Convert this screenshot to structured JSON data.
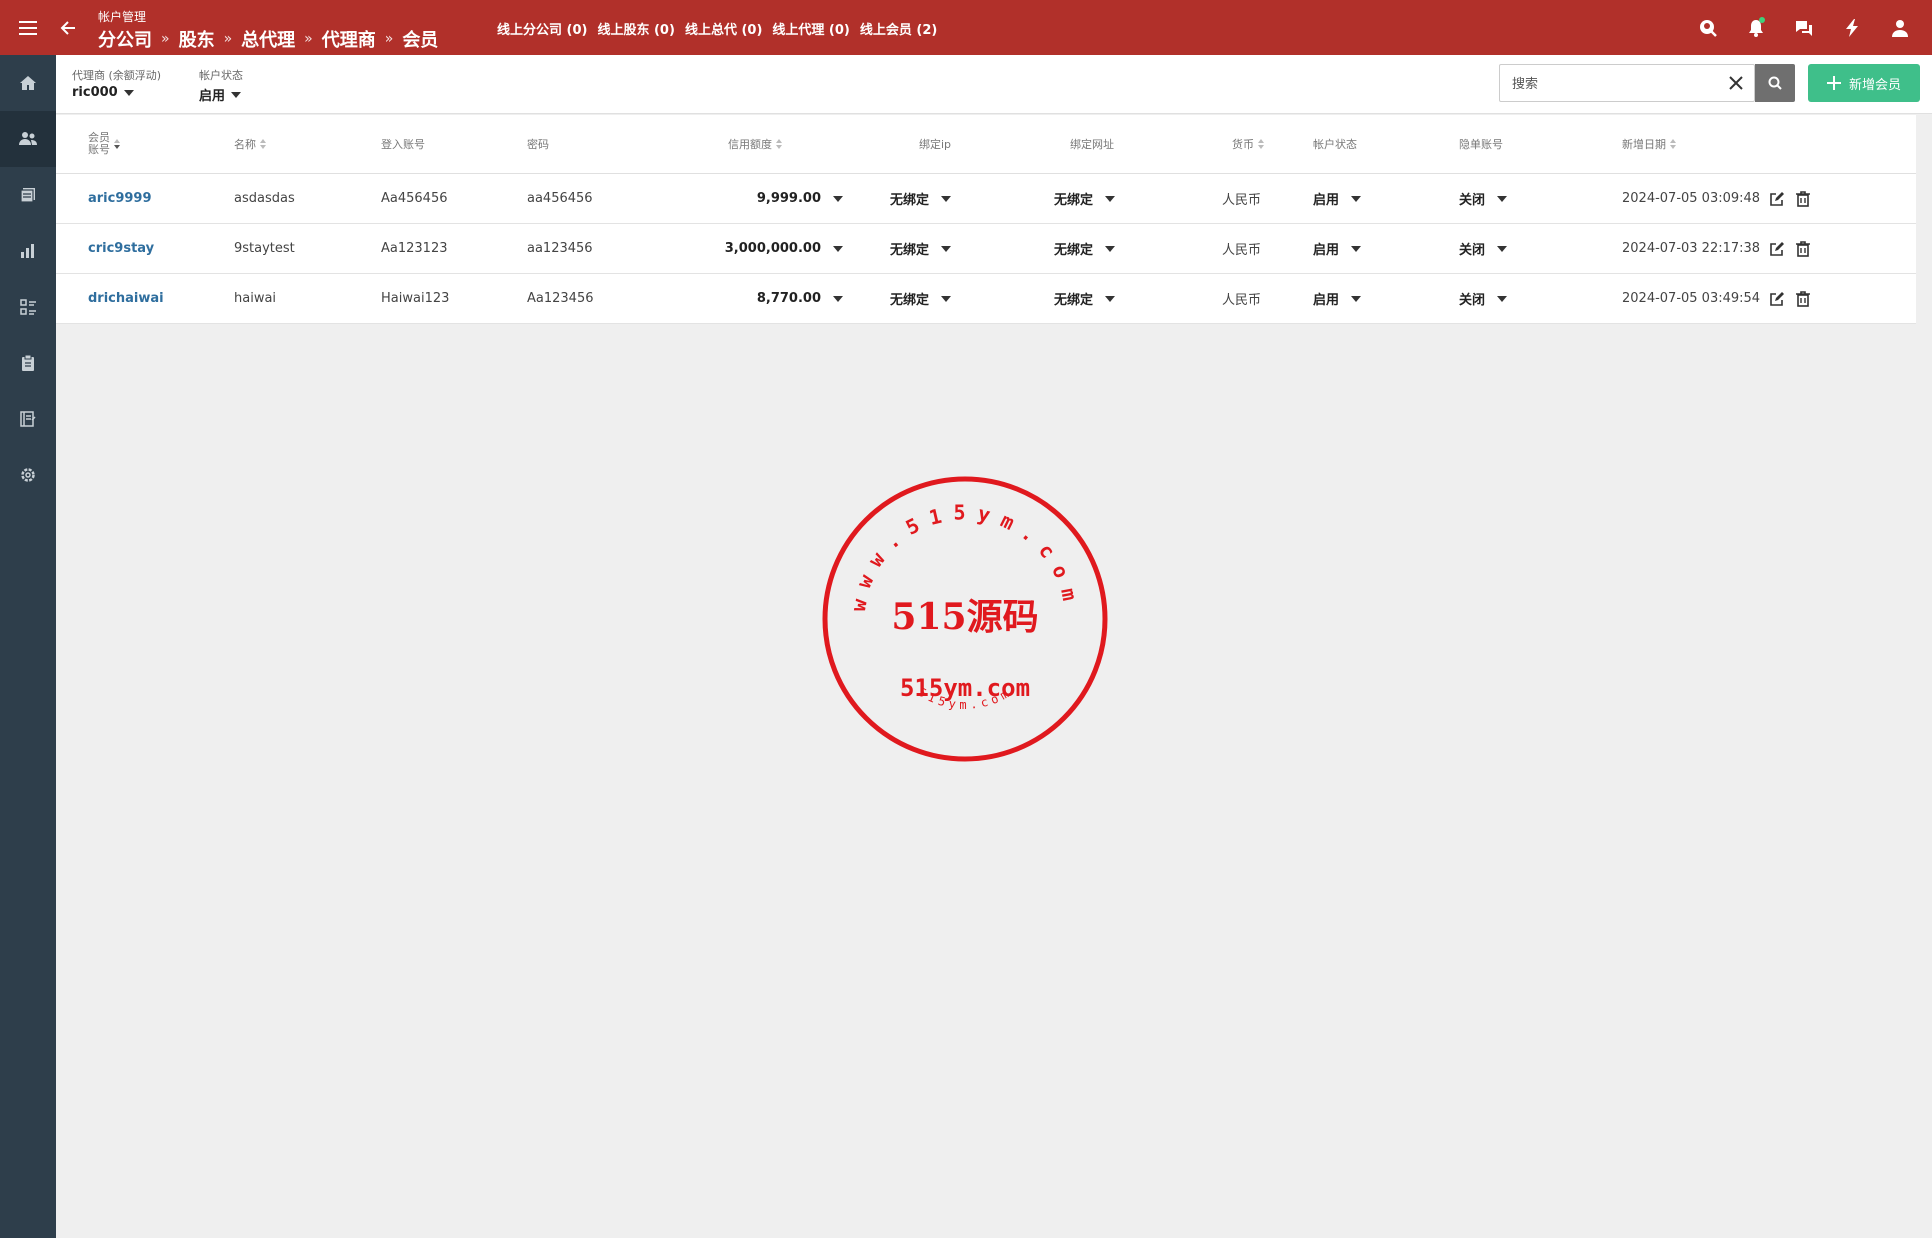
{
  "header": {
    "section_title": "帐户管理",
    "breadcrumb": [
      "分公司",
      "股东",
      "总代理",
      "代理商",
      "会员"
    ],
    "breadcrumb_sep": "»",
    "online_stats": [
      "线上分公司 (0)",
      "线上股东 (0)",
      "线上总代 (0)",
      "线上代理 (0)",
      "线上会员 (2)"
    ],
    "icons": [
      "menu-icon",
      "back-arrow-icon",
      "search-user-icon",
      "bell-icon",
      "chat-icon",
      "lightning-icon",
      "user-icon"
    ]
  },
  "sidebar": {
    "items": [
      {
        "icon": "home-icon",
        "active": false
      },
      {
        "icon": "users-icon",
        "active": true
      },
      {
        "icon": "documents-icon",
        "active": false
      },
      {
        "icon": "bar-chart-icon",
        "active": false
      },
      {
        "icon": "list-icon",
        "active": false
      },
      {
        "icon": "clipboard-icon",
        "active": false
      },
      {
        "icon": "notebook-icon",
        "active": false
      },
      {
        "icon": "gear-icon",
        "active": false
      }
    ]
  },
  "filters": {
    "agent_label": "代理商 (余额浮动)",
    "agent_value": "ric000",
    "status_label": "帐户状态",
    "status_value": "启用"
  },
  "search": {
    "placeholder": "搜索",
    "value": ""
  },
  "add_button_label": "新增会员",
  "table": {
    "columns": {
      "account": [
        "会员",
        "账号"
      ],
      "name": "名称",
      "login": "登入账号",
      "password": "密码",
      "credit": "信用额度",
      "bind_ip": "绑定ip",
      "bind_url": "绑定网址",
      "currency": "货币",
      "status": "帐户状态",
      "hidden": "隐单账号",
      "created": "新增日期"
    },
    "rows": [
      {
        "account": "aric9999",
        "name": "asdasdas",
        "login": "Aa456456",
        "password": "aa456456",
        "credit": "9,999.00",
        "bind_ip": "无绑定",
        "bind_url": "无绑定",
        "currency": "人民币",
        "status": "启用",
        "hidden": "关闭",
        "created": "2024-07-05 03:09:48"
      },
      {
        "account": "cric9stay",
        "name": "9staytest",
        "login": "Aa123123",
        "password": "aa123456",
        "credit": "3,000,000.00",
        "bind_ip": "无绑定",
        "bind_url": "无绑定",
        "currency": "人民币",
        "status": "启用",
        "hidden": "关闭",
        "created": "2024-07-03 22:17:38"
      },
      {
        "account": "drichaiwai",
        "name": "haiwai",
        "login": "Haiwai123",
        "password": "Aa123456",
        "credit": "8,770.00",
        "bind_ip": "无绑定",
        "bind_url": "无绑定",
        "currency": "人民币",
        "status": "启用",
        "hidden": "关闭",
        "created": "2024-07-05 03:49:54"
      }
    ]
  },
  "watermark": {
    "ring_text": "www.515ym.com",
    "center_text": "515源码",
    "url_text": "515ym.com",
    "bottom_text": "515ym.com",
    "color": "#e0191e"
  },
  "colors": {
    "header_bg": "#b1302a",
    "sidebar_bg": "#2e3e4b",
    "accent_green": "#3fbf8a",
    "link_blue": "#2f6e9e"
  }
}
